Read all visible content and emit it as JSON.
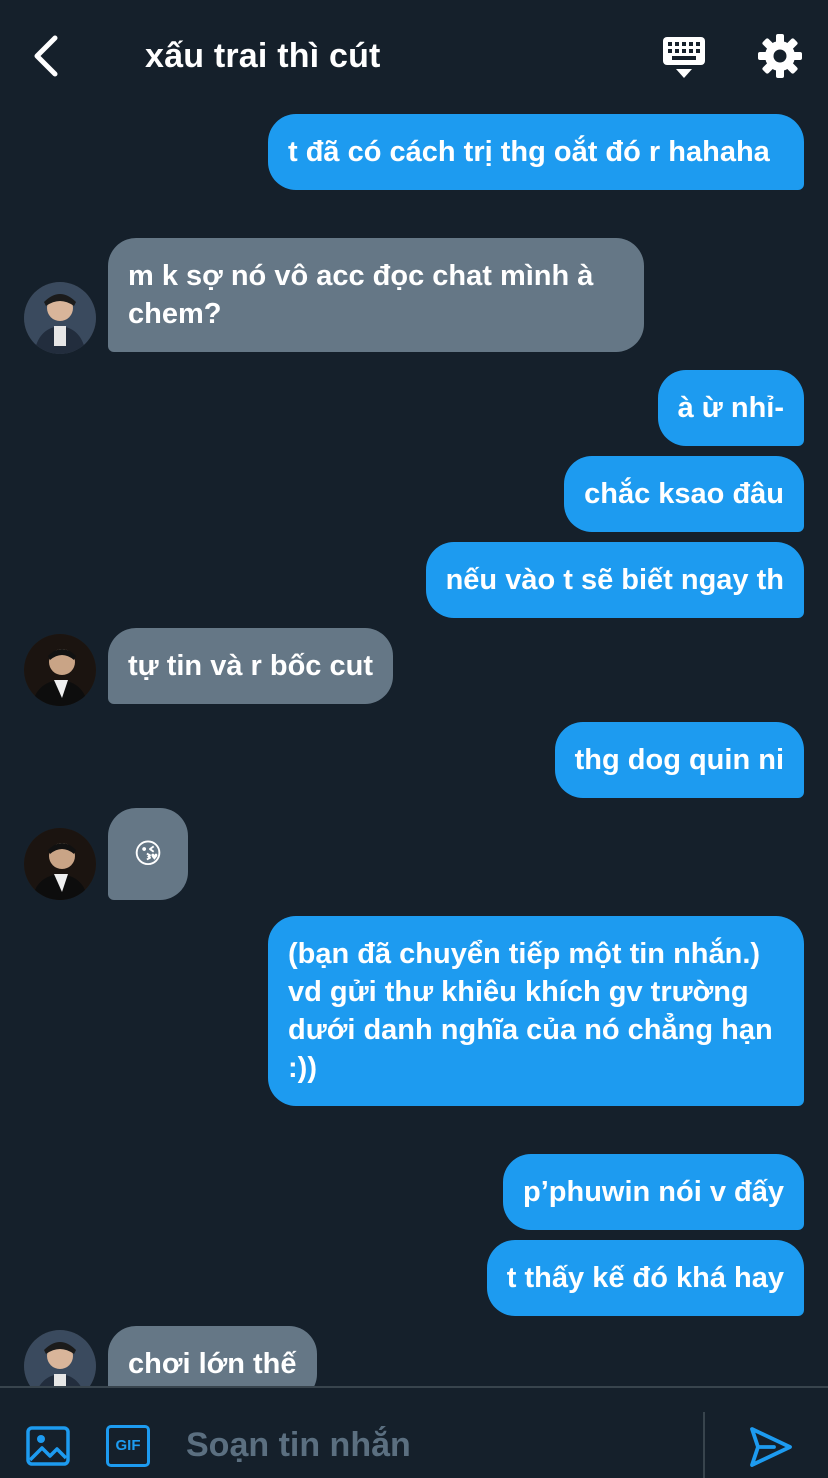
{
  "header": {
    "title": "xấu trai thì cút"
  },
  "messages": [
    {
      "dir": "out",
      "text": "t đã có cách trị thg oắt đó r hahaha"
    },
    {
      "dir": "in",
      "text": "m k sợ nó vô acc đọc chat mình à chem?"
    },
    {
      "dir": "out",
      "text": "à ừ nhỉ-"
    },
    {
      "dir": "out",
      "text": "chắc ksao đâu"
    },
    {
      "dir": "out",
      "text": "nếu vào t sẽ biết ngay th"
    },
    {
      "dir": "in",
      "text": "tự tin và r bốc cut"
    },
    {
      "dir": "out",
      "text": "thg dog quin ni"
    },
    {
      "dir": "in",
      "text": "😘"
    },
    {
      "dir": "out",
      "text": "(bạn đã chuyển tiếp một tin nhắn.)"
    },
    {
      "dir": "out",
      "text": "vd gửi thư khiêu khích gv trường dưới danh nghĩa của nó chẳng hạn :))"
    },
    {
      "dir": "out",
      "text": "p’phuwin nói v đấy"
    },
    {
      "dir": "out",
      "text": "t thấy kế đó khá hay"
    },
    {
      "dir": "in",
      "text": "chơi lớn thế"
    }
  ],
  "composer": {
    "placeholder": "Soạn tin nhắn",
    "gif_label": "GIF"
  },
  "icons": {
    "back": "chevron-left-icon",
    "keyboard": "keyboard-icon",
    "settings": "gear-icon",
    "image": "image-icon",
    "gif": "gif-icon",
    "send": "send-icon"
  },
  "colors": {
    "background": "#15202b",
    "outgoing": "#1d9bf0",
    "incoming": "#657786",
    "accent": "#1d9bf0"
  }
}
